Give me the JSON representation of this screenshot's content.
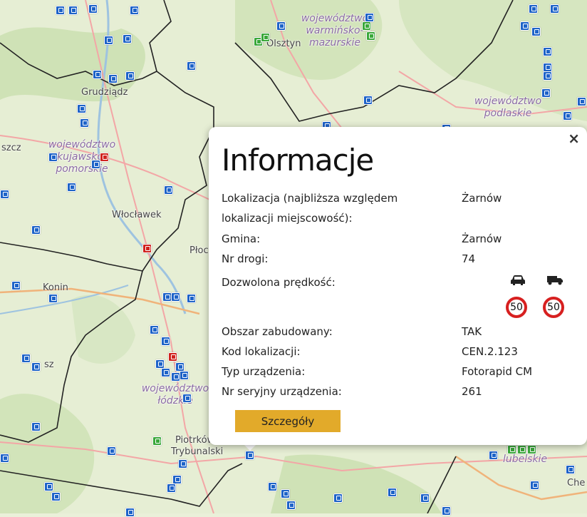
{
  "map": {
    "cities": [
      "Olsztyn",
      "Grudziądz",
      "Włocławek",
      "Płoc",
      "Konin",
      "Piotrków",
      "Trybunalski",
      "szcz",
      "sz",
      "Che"
    ],
    "regions": [
      "województwo warmińsko-mazurskie",
      "województwo podlaskie",
      "województwo kujawsko-pomorskie",
      "województwo łódzkie",
      "lubelskie"
    ]
  },
  "popup": {
    "title": "Informacje",
    "close": "×",
    "rows": [
      {
        "label": "Lokalizacja (najbliższa względem lokalizacji miejscowość):",
        "value": "Żarnów"
      },
      {
        "label": "Gmina:",
        "value": "Żarnów"
      },
      {
        "label": "Nr drogi:",
        "value": "74"
      },
      {
        "label": "Dozwolona prędkość:",
        "value": ""
      },
      {
        "label": "Obszar zabudowany:",
        "value": "TAK"
      },
      {
        "label": "Kod lokalizacji:",
        "value": "CEN.2.123"
      },
      {
        "label": "Typ urządzenia:",
        "value": "Fotorapid CM"
      },
      {
        "label": "Nr seryjny urządzenia:",
        "value": "261"
      }
    ],
    "speed": {
      "car": {
        "icon": "car-icon",
        "limit": "50"
      },
      "truck": {
        "icon": "truck-icon",
        "limit": "50"
      }
    },
    "details_button": "Szczegóły"
  },
  "colors": {
    "marker_blue": "#1e63c8",
    "marker_red": "#d0231e",
    "marker_green": "#3aa83a",
    "button": "#e2aa2a",
    "sign_border": "#d72020"
  }
}
